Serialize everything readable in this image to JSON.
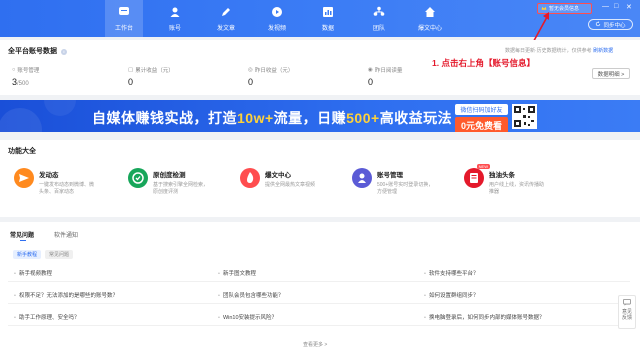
{
  "nav": {
    "items": [
      {
        "label": "工作台",
        "icon": "chat-icon",
        "active": true
      },
      {
        "label": "账号",
        "icon": "user-icon",
        "active": false
      },
      {
        "label": "发文章",
        "icon": "pen-icon",
        "active": false
      },
      {
        "label": "发视频",
        "icon": "play-icon",
        "active": false
      },
      {
        "label": "数据",
        "icon": "chart-icon",
        "active": false
      },
      {
        "label": "团队",
        "icon": "team-icon",
        "active": false
      },
      {
        "label": "爆文中心",
        "icon": "home-icon",
        "active": false
      }
    ]
  },
  "header": {
    "account_button": "暂无会员信息",
    "sync_button": "同步中心",
    "minimize": "—",
    "maximize": "□",
    "close": "✕"
  },
  "annotation": {
    "text": "1. 点击右上角【账号信息】",
    "color": "#e4192b"
  },
  "stats": {
    "title": "全平台账号数据",
    "note": "数据每日更新·历史数据统计，仅供参考",
    "note_link": "刷新数据",
    "items": [
      {
        "label": "账号管理",
        "value": "3",
        "suffix": "/500"
      },
      {
        "label": "累计收益（元）",
        "value": "0",
        "suffix": ""
      },
      {
        "label": "昨日收益（元）",
        "value": "0",
        "suffix": ""
      },
      {
        "label": "昨日阅读量",
        "value": "0",
        "suffix": ""
      }
    ],
    "detail_button": "数据明细 >"
  },
  "banner": {
    "text_part1": "自媒体赚钱实战，打造",
    "highlight1": "10w+",
    "text_part2": "流量，日赚",
    "highlight2": "500+",
    "text_part3": "高收益玩法",
    "promo_top": "微信扫码加好友",
    "promo_bottom": "0元免费看"
  },
  "features": {
    "title": "功能大全",
    "items": [
      {
        "name": "发动态",
        "desc": "一键发布动态到微博、微头条、百家动态",
        "color": "#ff8a1f",
        "icon": "send-icon",
        "new": false
      },
      {
        "name": "原创度检测",
        "desc": "基于搜索引擎全网检索，原创度评测",
        "color": "#17a65a",
        "icon": "check-icon",
        "new": false
      },
      {
        "name": "爆文中心",
        "desc": "提供全网最热文章视频",
        "color": "#ff4d4f",
        "icon": "fire-icon",
        "new": false
      },
      {
        "name": "账号管理",
        "desc": "500+账号实时登录切换，方便管理",
        "color": "#5b5bd6",
        "icon": "user-icon",
        "new": false
      },
      {
        "name": "独油头条",
        "desc": "用户线上线，资讯传播助推器",
        "color": "#e4192b",
        "icon": "news-icon",
        "new": true
      }
    ]
  },
  "faq": {
    "tabs": [
      "常见问题",
      "软件通知"
    ],
    "chips": [
      "新手教程",
      "常见问题"
    ],
    "rows": [
      [
        "新手视频教程",
        "新手图文教程",
        "软件支持哪些平台？"
      ],
      [
        "权限不足？无法添加的是哪些的账号数？",
        "团队会员包含哪些功能？",
        "如何设置群组同步？"
      ],
      [
        "助手工作原理、安全吗？",
        "Win10安装提示风险？",
        "换电脑登录后，如何同步内部的媒体账号数据？"
      ]
    ],
    "more": "查看更多 >"
  },
  "feedback": {
    "label": "意见反馈"
  }
}
